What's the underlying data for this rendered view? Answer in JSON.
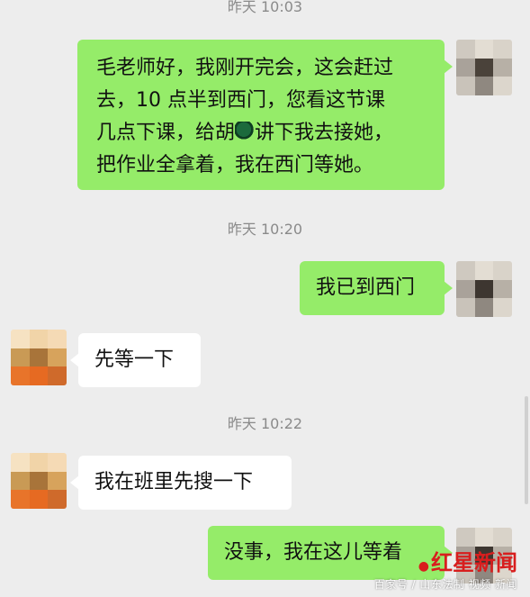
{
  "chat": {
    "timestamps": [
      "昨天 10:03",
      "昨天 10:20",
      "昨天 10:22"
    ],
    "messages": [
      {
        "side": "right",
        "lines": [
          "毛老师好，我刚开完会，这会赶过",
          "去，10 点半到西门，您看这节课",
          "几点下课，给胡",
          "讲下我去接她，",
          "把作业全拿着，我在西门等她。"
        ]
      },
      {
        "side": "right",
        "text": "我已到西门"
      },
      {
        "side": "left",
        "text": "先等一下"
      },
      {
        "side": "left",
        "text": "我在班里先搜一下"
      },
      {
        "side": "right",
        "text": "没事，我在这儿等着"
      }
    ]
  },
  "watermark": {
    "logo": "红星新闻",
    "text": "百家号 / 山东法制 视频 新闻"
  },
  "colors": {
    "background": "#ededed",
    "sent_bubble": "#95ec69",
    "received_bubble": "#ffffff",
    "timestamp_text": "#8a8a8a"
  },
  "icons": {
    "self_avatar": "mosaic-avatar-icon",
    "other_avatar": "mosaic-avatar-icon"
  }
}
